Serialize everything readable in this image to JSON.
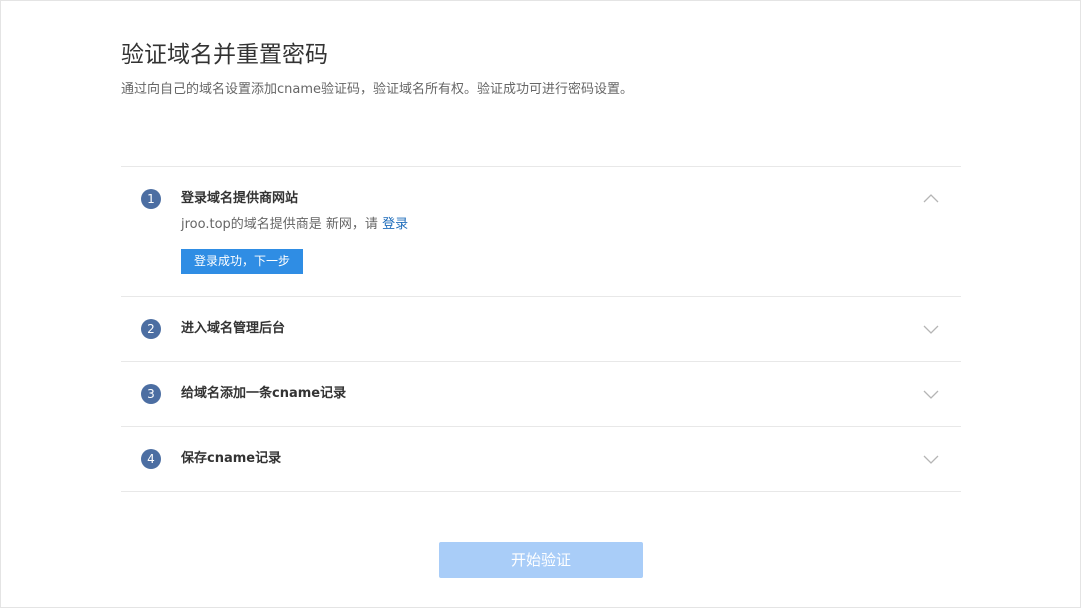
{
  "header": {
    "title": "验证域名并重置密码",
    "subtitle": "通过向自己的域名设置添加cname验证码，验证域名所有权。验证成功可进行密码设置。"
  },
  "steps": [
    {
      "number": "1",
      "title": "登录域名提供商网站",
      "expanded": true,
      "toggle_icon": "chevron-up-icon",
      "description_prefix": "jroo.top的域名提供商是 新网，请 ",
      "login_link": "登录",
      "next_button": "登录成功，下一步"
    },
    {
      "number": "2",
      "title": "进入域名管理后台",
      "expanded": false,
      "toggle_icon": "chevron-down-icon"
    },
    {
      "number": "3",
      "title": "给域名添加一条cname记录",
      "expanded": false,
      "toggle_icon": "chevron-down-icon"
    },
    {
      "number": "4",
      "title": "保存cname记录",
      "expanded": false,
      "toggle_icon": "chevron-down-icon"
    }
  ],
  "footer": {
    "start_button": "开始验证",
    "start_button_disabled": true
  },
  "colors": {
    "step_badge": "#4c6ea2",
    "primary_button": "#2f8de4",
    "disabled_button": "#a9cdf8",
    "link": "#1f6dbb"
  }
}
